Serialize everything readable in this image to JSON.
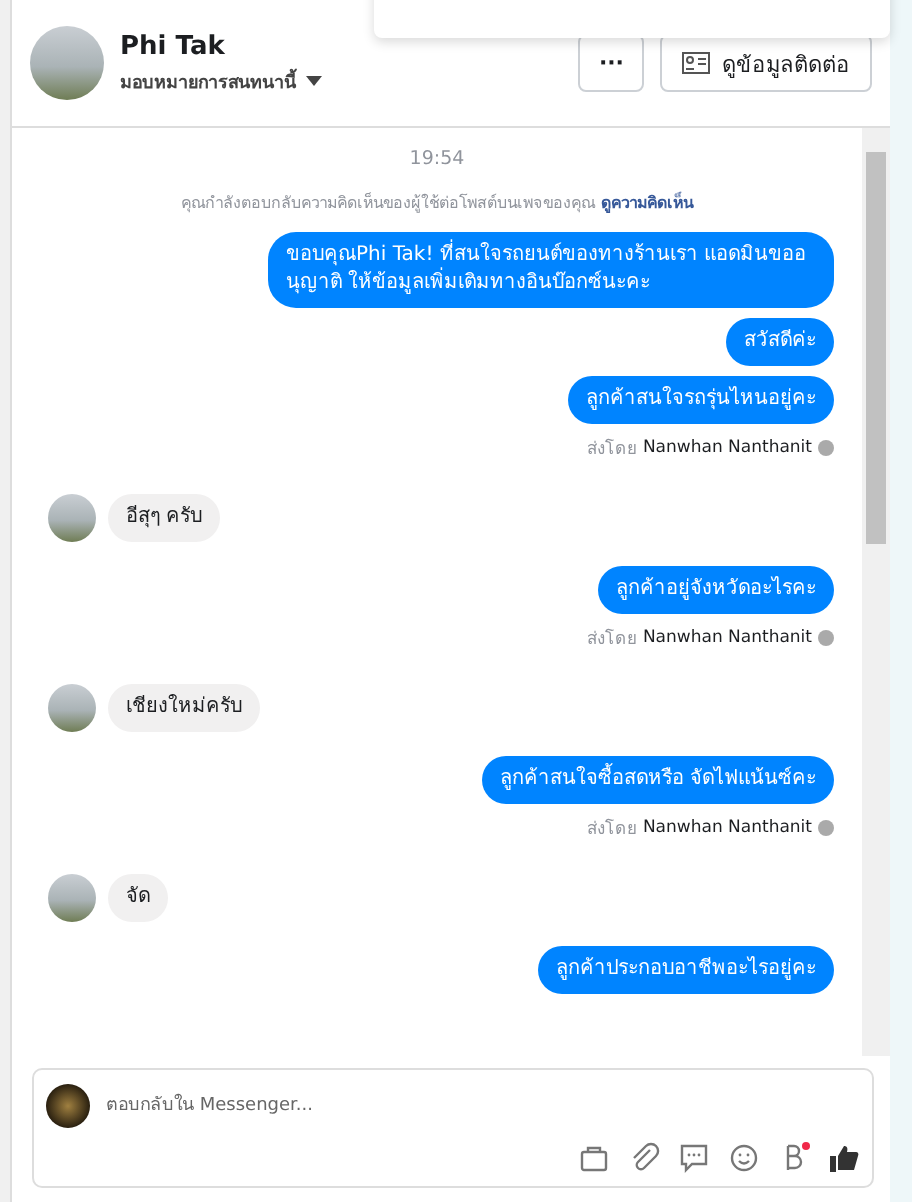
{
  "header": {
    "name": "Phi Tak",
    "assign_label": "มอบหมายการสนทนานี้",
    "more_button": "···",
    "contact_button": "ดูข้อมูลติดต่อ"
  },
  "chat": {
    "time": "19:54",
    "notice": "คุณกำลังตอบกลับความคิดเห็นของผู้ใช้ต่อโพสต์บนเพจของคุณ",
    "notice_link": "ดูความคิดเห็น",
    "messages": [
      {
        "kind": "outgoing",
        "text": "ขอบคุณPhi Tak! ที่สนใจรถยนต์ของทางร้านเรา แอดมินขออนุญาติ ให้ข้อมูลเพิ่มเติมทางอินบ๊อกซ์นะคะ"
      },
      {
        "kind": "outgoing",
        "text": "สวัสดีค่ะ"
      },
      {
        "kind": "outgoing",
        "text": "ลูกค้าสนใจรถรุ่นไหนอยู่คะ",
        "sent_by_label": "ส่งโดย",
        "sent_by": "Nanwhan Nanthanit"
      },
      {
        "kind": "incoming",
        "text": "อีสุๆ ครับ"
      },
      {
        "kind": "outgoing",
        "text": "ลูกค้าอยู่จังหวัดอะไรคะ",
        "sent_by_label": "ส่งโดย",
        "sent_by": "Nanwhan Nanthanit"
      },
      {
        "kind": "incoming",
        "text": "เชียงใหม่ครับ"
      },
      {
        "kind": "outgoing",
        "text": "ลูกค้าสนใจซื้อสดหรือ จัดไฟแน้นซ์คะ",
        "sent_by_label": "ส่งโดย",
        "sent_by": "Nanwhan Nanthanit"
      },
      {
        "kind": "incoming",
        "text": "จัด"
      },
      {
        "kind": "outgoing",
        "text": "ลูกค้าประกอบอาชีพอะไรอยู่คะ"
      }
    ]
  },
  "composer": {
    "placeholder": "ตอบกลับใน Messenger..."
  }
}
